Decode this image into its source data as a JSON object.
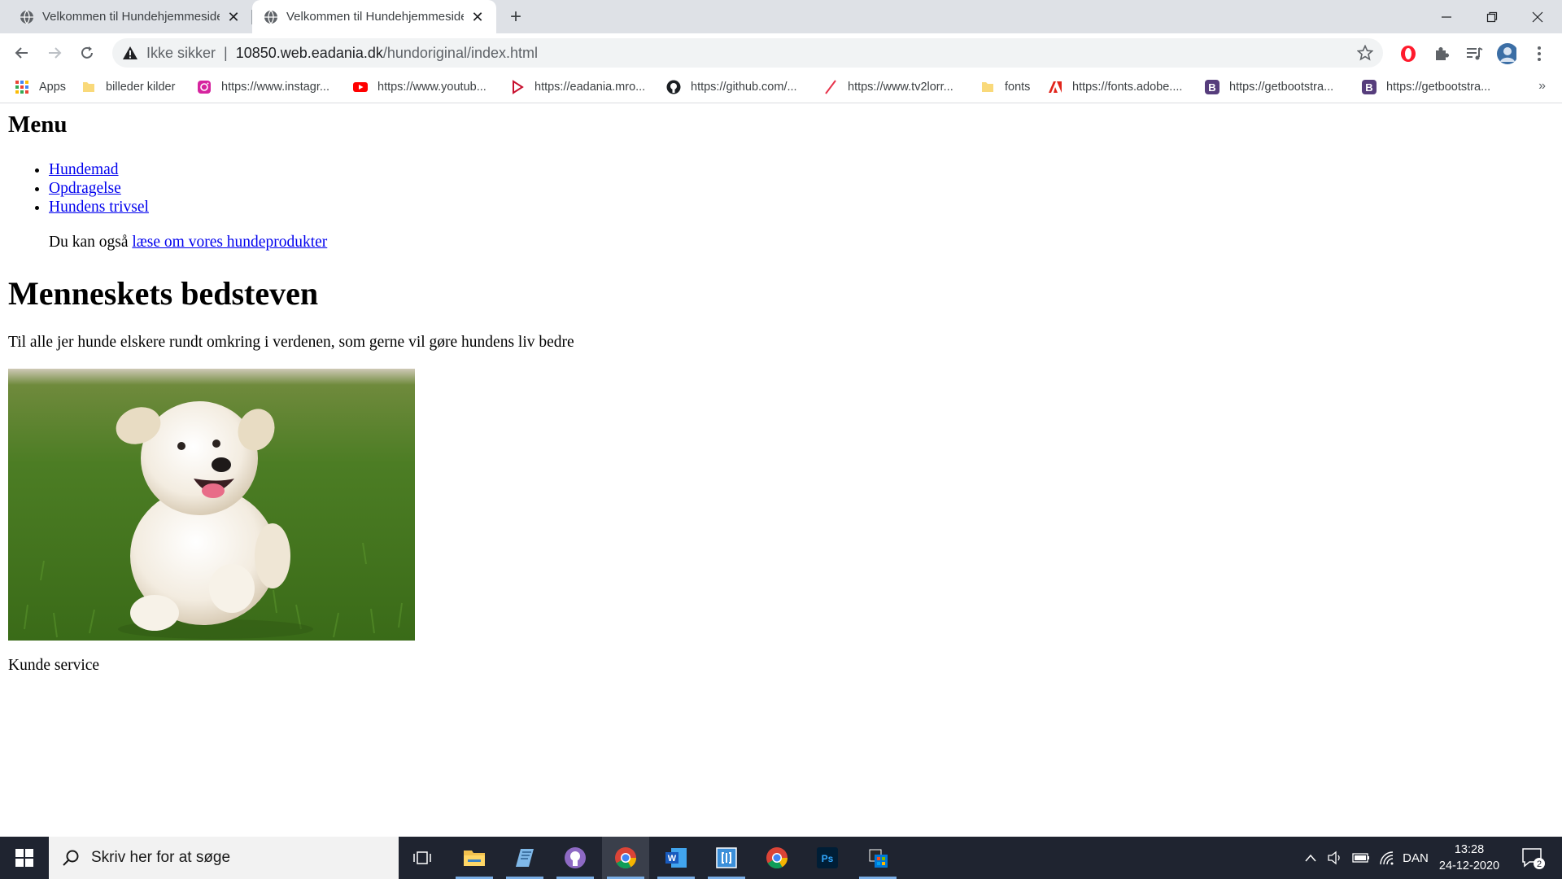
{
  "browser": {
    "tabs": [
      {
        "title": "Velkommen til Hundehjemmeside",
        "active": false
      },
      {
        "title": "Velkommen til Hundehjemmeside",
        "active": true
      }
    ],
    "new_tab_label": "+",
    "address": {
      "security_label": "Ikke sikker",
      "separator": "|",
      "host": "10850.web.eadania.dk",
      "path": "/hundoriginal/index.html"
    },
    "bookmarks": [
      {
        "label": "Apps",
        "icon": "apps-grid-icon"
      },
      {
        "label": "billeder kilder",
        "icon": "folder-icon"
      },
      {
        "label": "https://www.instagr...",
        "icon": "instagram-icon"
      },
      {
        "label": "https://www.youtub...",
        "icon": "youtube-icon"
      },
      {
        "label": "https://eadania.mro...",
        "icon": "eadania-icon"
      },
      {
        "label": "https://github.com/...",
        "icon": "github-icon"
      },
      {
        "label": "https://www.tv2lorr...",
        "icon": "tv2-icon"
      },
      {
        "label": "fonts",
        "icon": "folder-icon"
      },
      {
        "label": "https://fonts.adobe....",
        "icon": "adobe-icon"
      },
      {
        "label": "https://getbootstra...",
        "icon": "bootstrap-icon"
      },
      {
        "label": "https://getbootstra...",
        "icon": "bootstrap-icon"
      }
    ],
    "bookmarks_more": "»"
  },
  "page": {
    "menu_heading": "Menu",
    "menu_items": [
      "Hundemad",
      "Opdragelse",
      "Hundens trivsel"
    ],
    "also_text": "Du kan også ",
    "also_link": "læse om vores hundeprodukter",
    "main_heading": "Menneskets bedsteven",
    "lead": "Til alle jer hunde elskere rundt omkring i verdenen, som gerne vil gøre hundens liv bedre",
    "image_subject": "puppy running on grass",
    "footer": "Kunde service"
  },
  "taskbar": {
    "search_placeholder": "Skriv her for at søge",
    "language": "DAN",
    "time": "13:28",
    "date": "24-12-2020",
    "notification_count": "2"
  },
  "colors": {
    "tabstrip": "#dee1e6",
    "link": "#0000ee",
    "taskbar": "#1f2430"
  }
}
